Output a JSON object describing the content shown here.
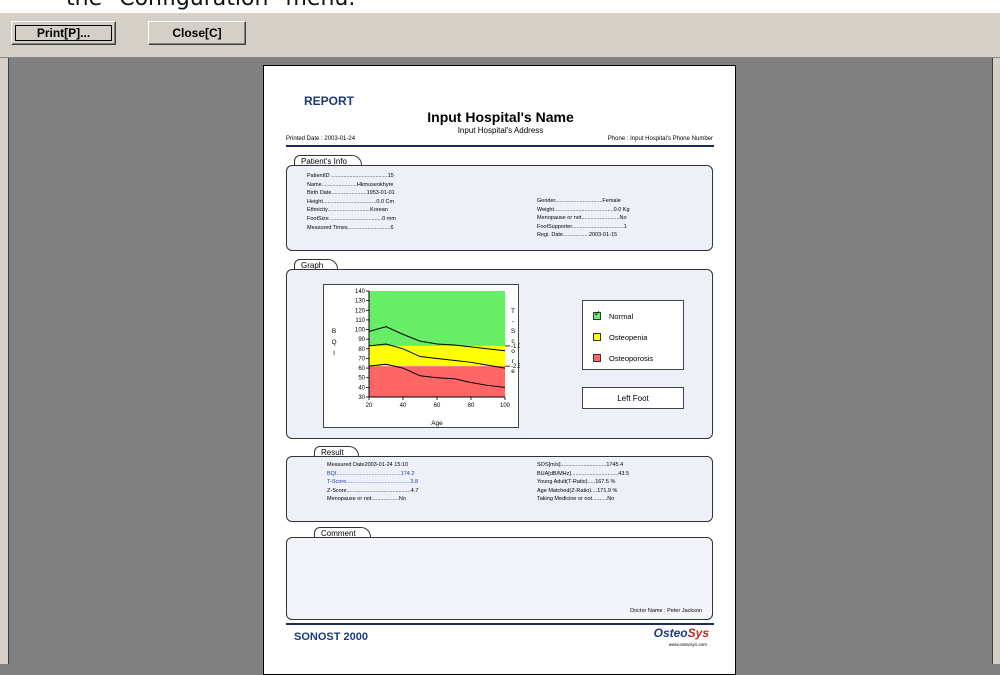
{
  "caption_text": "the \"Configuration\" menu.",
  "toolbar": {
    "print_label": "Print[P]...",
    "close_label": "Close[C]"
  },
  "report": {
    "heading": "REPORT",
    "hospital_name": "Input Hospital's Name",
    "hospital_address": "Input Hospital's Address",
    "printed_date": "Printed Date : 2003-01-24",
    "phone": "Phone : Input Hospital's Phone Number",
    "patient_tab": "Patient's Info",
    "patient_left": [
      "PatientID .....................................15",
      "Name.......................Hkmuseokhyre",
      "Birth Date.......................1953-01-01",
      "Height...................................0.0 Cm",
      "Ethnicity............................Korean",
      "FootSize...................................0 mm",
      "Measured Times............................6"
    ],
    "patient_right": [
      "Gender...............................Female",
      "Weight.......................................0.0 Kg",
      "Menopause or not.........................No",
      "FootSupporter..................................1",
      "Regi. Date.................2003-01-15"
    ],
    "graph_tab": "Graph",
    "result_tab": "Result",
    "result_left": [
      "Measured Date2003-01-24 15:10",
      "BQI..........................................174.2",
      "T-Score..........................................3.8",
      "Z-Score..........................................4.7",
      "Menopause or not..................No"
    ],
    "result_right": [
      "SOS[m/s]..............................1745.4",
      "BUA[dB/MHz]...............................43.5",
      "Young Adult(T-Ratio).....167.5 %",
      "Age Matched(Z-Ratio)....171.9 %",
      "Taking Medicine or not..........No"
    ],
    "comment_tab": "Comment",
    "doctor": "Doctor Name : Peter Jackson",
    "device": "SONOST 2000",
    "logo_a": "Osteo",
    "logo_b": "Sys",
    "logo_url": "www.osteosys.com"
  },
  "chart_data": {
    "type": "line",
    "y_label": "BQI",
    "x_label": "Age",
    "right_label": "T-Score",
    "y_ticks": [
      140,
      130,
      120,
      110,
      100,
      90,
      80,
      70,
      60,
      50,
      40,
      30
    ],
    "x_ticks": [
      20,
      40,
      60,
      80,
      100
    ],
    "xlim": [
      20,
      100
    ],
    "ylim": [
      30,
      140
    ],
    "t_marks": [
      "-1.0",
      "-2.5"
    ],
    "zones": [
      {
        "name": "Normal",
        "from": 83,
        "to": 140,
        "color": "#66ee66"
      },
      {
        "name": "Osteopenia",
        "from": 62,
        "to": 83,
        "color": "#ffff00"
      },
      {
        "name": "Osteoporosis",
        "from": 30,
        "to": 62,
        "color": "#ff6666"
      }
    ],
    "series": [
      {
        "x": [
          20,
          30,
          40,
          50,
          60,
          70,
          80,
          90,
          100
        ],
        "values": [
          98,
          103,
          95,
          88,
          85,
          84,
          82,
          80,
          78
        ]
      },
      {
        "x": [
          20,
          30,
          40,
          50,
          60,
          70,
          80,
          90,
          100
        ],
        "values": [
          83,
          85,
          80,
          72,
          70,
          68,
          66,
          63,
          60
        ]
      },
      {
        "x": [
          20,
          30,
          40,
          50,
          60,
          70,
          80,
          90,
          100
        ],
        "values": [
          62,
          64,
          60,
          52,
          50,
          49,
          45,
          42,
          40
        ]
      }
    ]
  },
  "legend": {
    "normal": "Normal",
    "osteopenia": "Osteopenia",
    "osteoporosis": "Osteoporosis",
    "foot": "Left Foot"
  }
}
